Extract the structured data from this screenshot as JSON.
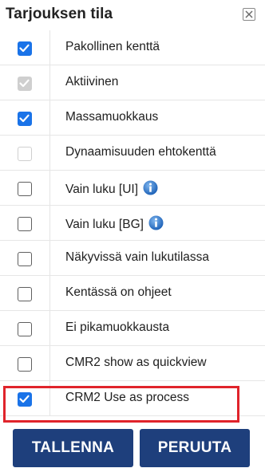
{
  "dialog": {
    "title": "Tarjouksen tila",
    "close_icon": "close-x-icon"
  },
  "options": [
    {
      "label": "Pakollinen kenttä",
      "checked": true,
      "disabled": false,
      "info": false
    },
    {
      "label": "Aktiivinen",
      "checked": true,
      "disabled": true,
      "info": false
    },
    {
      "label": "Massamuokkaus",
      "checked": true,
      "disabled": false,
      "info": false
    },
    {
      "label": "Dynaamisuuden ehtokenttä",
      "checked": false,
      "disabled": true,
      "info": false
    },
    {
      "label": "Vain luku [UI]",
      "checked": false,
      "disabled": false,
      "info": true
    },
    {
      "label": "Vain luku [BG]",
      "checked": false,
      "disabled": false,
      "info": true
    },
    {
      "label": "Näkyvissä vain lukutilassa",
      "checked": false,
      "disabled": false,
      "info": false
    },
    {
      "label": "Kentässä on ohjeet",
      "checked": false,
      "disabled": false,
      "info": false
    },
    {
      "label": "Ei pikamuokkausta",
      "checked": false,
      "disabled": false,
      "info": false
    },
    {
      "label": "CMR2 show as quickview",
      "checked": false,
      "disabled": false,
      "info": false
    },
    {
      "label": "CRM2 Use as process",
      "checked": true,
      "disabled": false,
      "info": false,
      "highlighted": true
    }
  ],
  "buttons": {
    "save_label": "TALLENNA",
    "cancel_label": "PERUUTA"
  },
  "colors": {
    "accent": "#1a73e8",
    "button_bg": "#1e3f7c",
    "highlight": "#e0242b",
    "info_icon": "#2f7fd0"
  }
}
